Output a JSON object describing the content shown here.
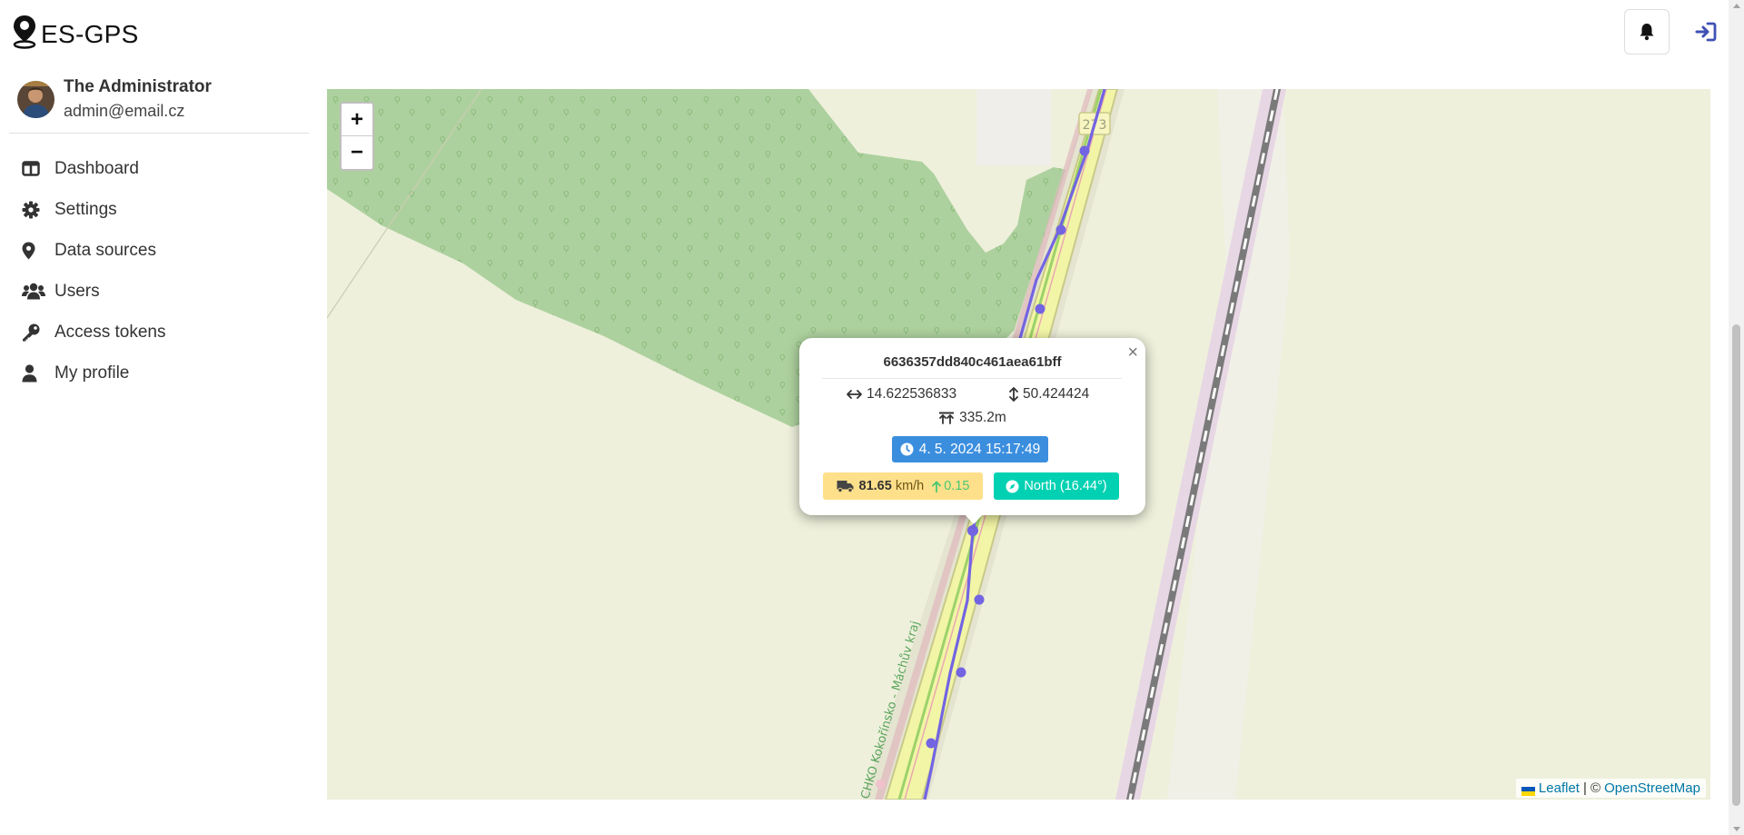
{
  "app": {
    "title": "ES-GPS"
  },
  "user": {
    "name": "The Administrator",
    "email": "admin@email.cz"
  },
  "sidebar": {
    "items": [
      {
        "label": "Dashboard",
        "icon": "table-columns-icon"
      },
      {
        "label": "Settings",
        "icon": "gear-icon"
      },
      {
        "label": "Data sources",
        "icon": "map-marker-icon"
      },
      {
        "label": "Users",
        "icon": "users-icon"
      },
      {
        "label": "Access tokens",
        "icon": "key-icon"
      },
      {
        "label": "My profile",
        "icon": "user-icon"
      }
    ]
  },
  "map": {
    "zoom_in": "+",
    "zoom_out": "−",
    "road_label": "273",
    "area_label": "CHKO Kokořínsko - Máchův kraj",
    "attribution": {
      "leaflet": "Leaflet",
      "separator": "| ©",
      "osm": "OpenStreetMap"
    },
    "colors": {
      "forest": "#add19e",
      "farmland": "#eef0dc",
      "track": "#7364e2",
      "road": "#f2f5a6",
      "railway": "#707070"
    }
  },
  "popup": {
    "title": "6636357dd840c461aea61bff",
    "close": "×",
    "longitude": "14.622536833",
    "latitude": "50.424424",
    "altitude": "335.2m",
    "timestamp": "4. 5. 2024 15:17:49",
    "speed_value": "81.65",
    "speed_unit": "km/h",
    "acceleration": "0.15",
    "direction": "North (16.44°)"
  }
}
